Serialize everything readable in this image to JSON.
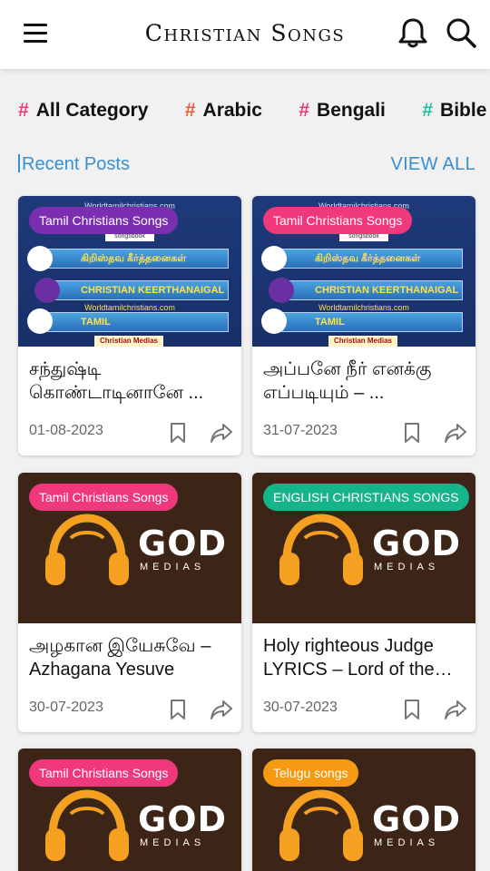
{
  "app": {
    "title": "Christian Songs"
  },
  "icons": {
    "menu": "menu-icon",
    "bell": "bell-icon",
    "search": "search-icon",
    "bookmark": "bookmark-icon",
    "share": "share-icon"
  },
  "categories": [
    {
      "hash": "#",
      "label": "All Category",
      "hash_color": "#f0397a"
    },
    {
      "hash": "#",
      "label": "Arabic",
      "hash_color": "#f05a3a"
    },
    {
      "hash": "#",
      "label": "Bengali",
      "hash_color": "#f0397a"
    },
    {
      "hash": "#",
      "label": "Bible",
      "hash_color": "#1fbfa0"
    }
  ],
  "section": {
    "title": "Recent Posts",
    "view_all": "VIEW ALL",
    "accent": "#3a8fd0"
  },
  "thumb_blue": {
    "small_top": "Worldtamilchristians.com",
    "songsbook": "songsbook",
    "bar1": "கிறிஸ்தவ கீர்த்தனைகள்",
    "bar2": "CHRISTIAN KEERTHANAIGAL",
    "site": "Worldtamilchristians.com",
    "bar3": "TAMIL",
    "footer": "Christian Medias"
  },
  "thumb_brown": {
    "logo": "GOD",
    "sub": "MEDIAS"
  },
  "posts": [
    {
      "badge": "Tamil Christians Songs",
      "badge_color": "#7b2fb0",
      "thumb": "blue",
      "title": "சந்துஷ்டி கொண்டாடினானே ...",
      "date": "01-08-2023"
    },
    {
      "badge": "Tamil Christians Songs",
      "badge_color": "#f0397a",
      "thumb": "blue",
      "title": "அப்பனே நீர் எனக்கு எப்படியும் – ...",
      "date": "31-07-2023"
    },
    {
      "badge": "Tamil Christians Songs",
      "badge_color": "#f0397a",
      "thumb": "brown",
      "title": "அழகான இயேசுவே – Azhagana Yesuve",
      "date": "30-07-2023"
    },
    {
      "badge": "ENGLISH CHRISTIANS SONGS",
      "badge_color": "#15b48a",
      "thumb": "brown",
      "title": "Holy righteous Judge LYRICS – Lord of the N...",
      "date": "30-07-2023"
    },
    {
      "badge": "Tamil Christians Songs",
      "badge_color": "#f0397a",
      "thumb": "brown",
      "title": "",
      "date": ""
    },
    {
      "badge": "Telugu songs",
      "badge_color": "#f59a12",
      "thumb": "brown",
      "title": "",
      "date": ""
    }
  ]
}
